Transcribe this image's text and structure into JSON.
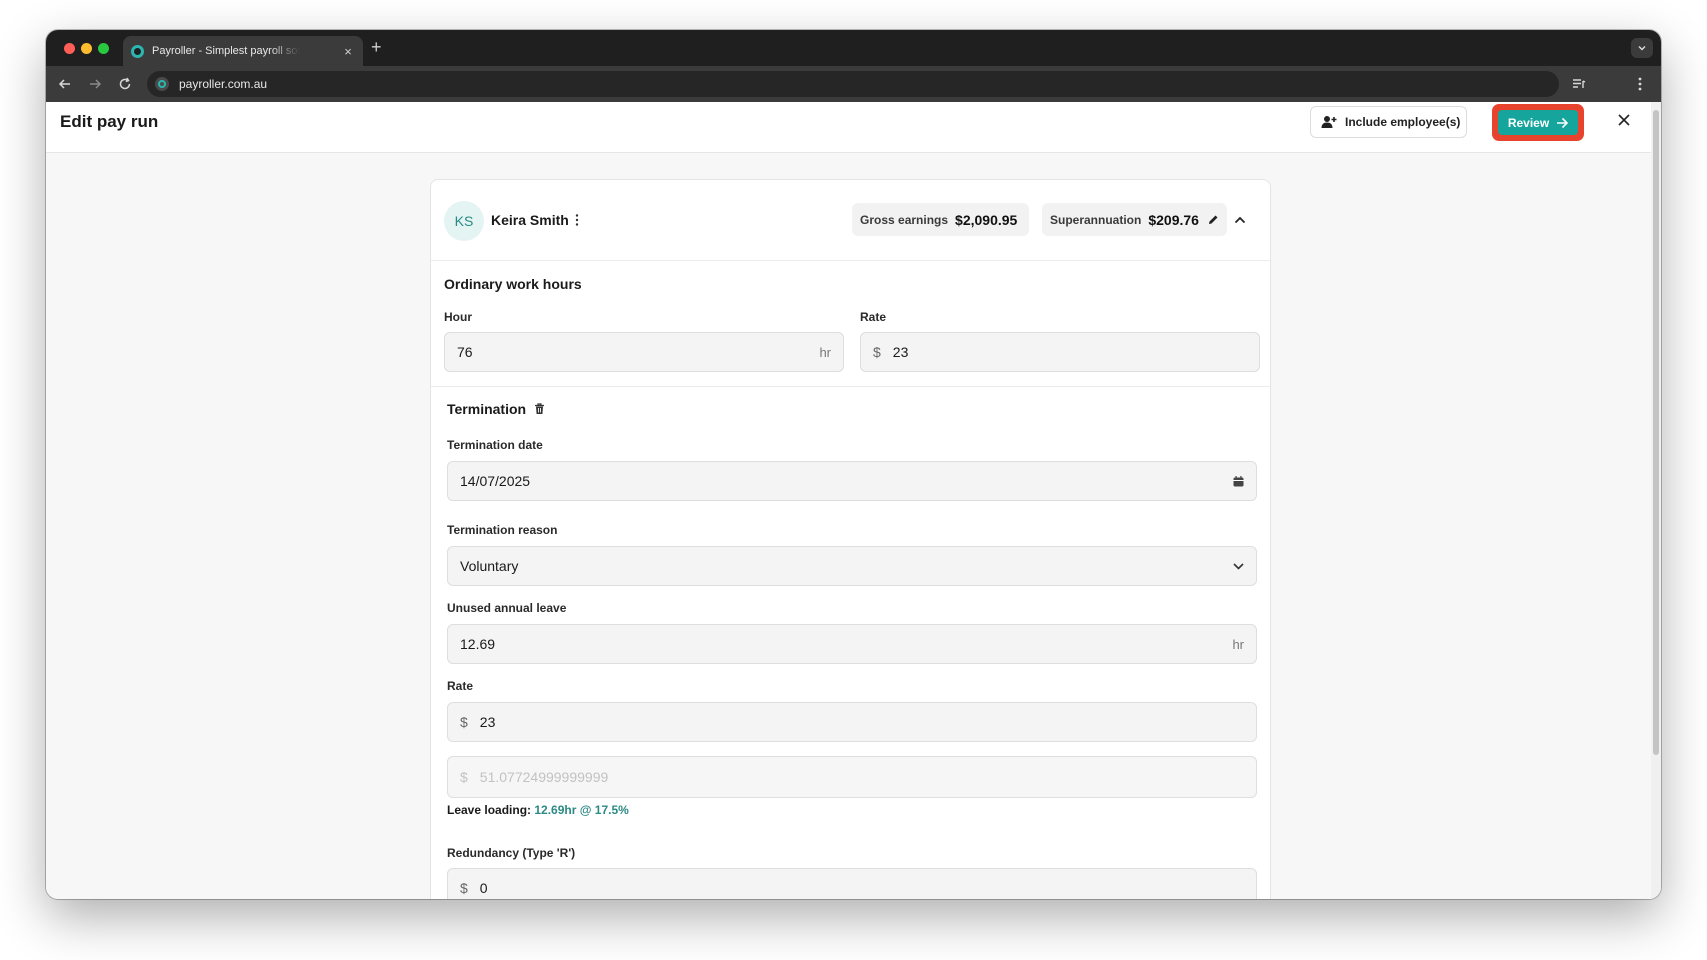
{
  "browser": {
    "tab_title": "Payroller - Simplest payroll software",
    "tab_close": "×",
    "new_tab": "+",
    "url": "payroller.com.au"
  },
  "header": {
    "title": "Edit pay run",
    "include_label": "Include employee(s)",
    "review_label": "Review"
  },
  "employee": {
    "initials": "KS",
    "name": "Keira Smith",
    "gross_label": "Gross earnings",
    "gross_value": "$2,090.95",
    "super_label": "Superannuation",
    "super_value": "$209.76"
  },
  "ordinary": {
    "title": "Ordinary work hours",
    "hour_label": "Hour",
    "hour_value": "76",
    "hour_suffix": "hr",
    "rate_label": "Rate",
    "rate_prefix": "$",
    "rate_value": "23"
  },
  "termination": {
    "title": "Termination",
    "date_label": "Termination date",
    "date_value": "14/07/2025",
    "reason_label": "Termination reason",
    "reason_value": "Voluntary",
    "unused_label": "Unused annual leave",
    "unused_value": "12.69",
    "unused_suffix": "hr",
    "rate_label": "Rate",
    "rate_prefix": "$",
    "rate_value": "23",
    "loading_prefix": "$",
    "loading_value": "51.07724999999999",
    "loading_hint_label": "Leave loading:",
    "loading_hint_value": "12.69hr @ 17.5%",
    "redundancy_label": "Redundancy (Type 'R')",
    "redundancy_prefix": "$",
    "redundancy_value": "0"
  },
  "colors": {
    "accent": "#16a59c",
    "highlight": "#e8432d"
  }
}
